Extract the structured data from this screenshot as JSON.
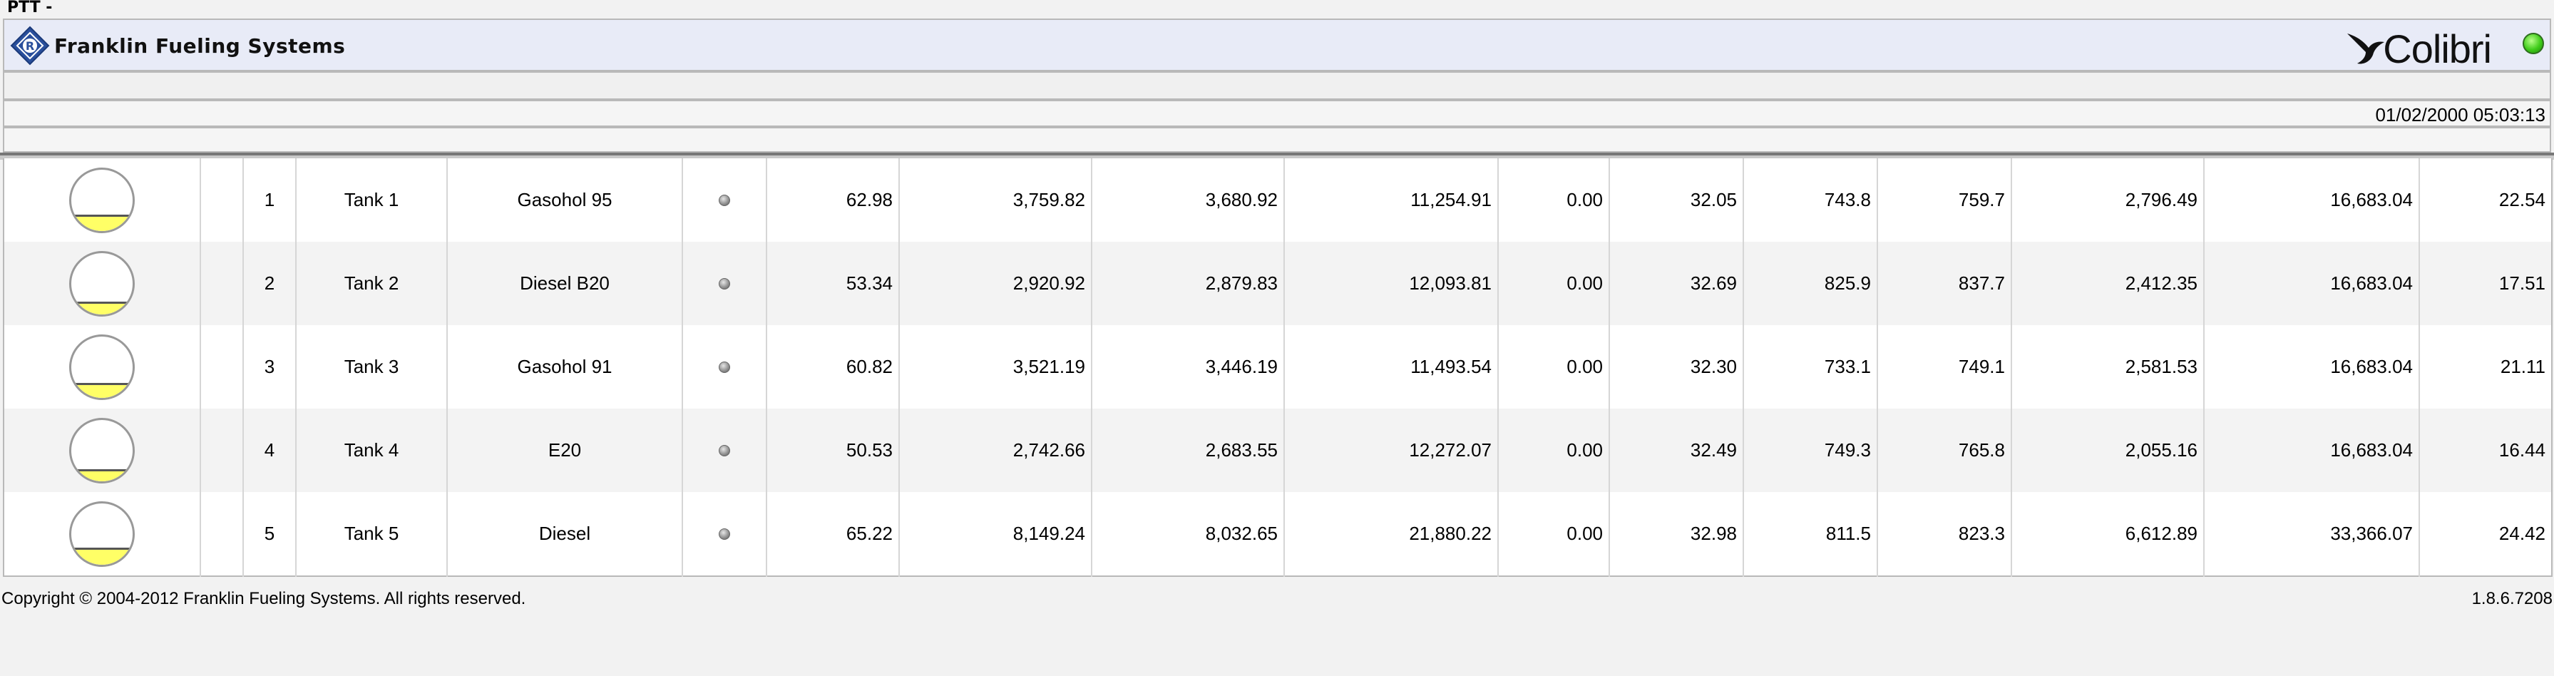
{
  "window": {
    "title": "PTT -"
  },
  "header": {
    "brand_name": "Franklin Fueling Systems",
    "product_logo_text": "Colibri",
    "brand_icon": "franklin-diamond-logo",
    "status_color": "#44cc22"
  },
  "info_bar": {
    "datetime": "01/02/2000 05:03:13"
  },
  "colors": {
    "gauge_fill": "#ffff66",
    "row_alt": "#f3f3f3"
  },
  "tanks": [
    {
      "level": 0.23,
      "number": "1",
      "name": "Tank 1",
      "product": "Gasohol 95",
      "v1": "62.98",
      "v2": "3,759.82",
      "v3": "3,680.92",
      "v4": "11,254.91",
      "v5": "0.00",
      "v6": "32.05",
      "v7": "743.8",
      "v8": "759.7",
      "v9": "2,796.49",
      "v10": "16,683.04",
      "v11": "22.54"
    },
    {
      "level": 0.18,
      "number": "2",
      "name": "Tank 2",
      "product": "Diesel B20",
      "v1": "53.34",
      "v2": "2,920.92",
      "v3": "2,879.83",
      "v4": "12,093.81",
      "v5": "0.00",
      "v6": "32.69",
      "v7": "825.9",
      "v8": "837.7",
      "v9": "2,412.35",
      "v10": "16,683.04",
      "v11": "17.51"
    },
    {
      "level": 0.21,
      "number": "3",
      "name": "Tank 3",
      "product": "Gasohol 91",
      "v1": "60.82",
      "v2": "3,521.19",
      "v3": "3,446.19",
      "v4": "11,493.54",
      "v5": "0.00",
      "v6": "32.30",
      "v7": "733.1",
      "v8": "749.1",
      "v9": "2,581.53",
      "v10": "16,683.04",
      "v11": "21.11"
    },
    {
      "level": 0.16,
      "number": "4",
      "name": "Tank 4",
      "product": "E20",
      "v1": "50.53",
      "v2": "2,742.66",
      "v3": "2,683.55",
      "v4": "12,272.07",
      "v5": "0.00",
      "v6": "32.49",
      "v7": "749.3",
      "v8": "765.8",
      "v9": "2,055.16",
      "v10": "16,683.04",
      "v11": "16.44"
    },
    {
      "level": 0.24,
      "number": "5",
      "name": "Tank 5",
      "product": "Diesel",
      "v1": "65.22",
      "v2": "8,149.24",
      "v3": "8,032.65",
      "v4": "21,880.22",
      "v5": "0.00",
      "v6": "32.98",
      "v7": "811.5",
      "v8": "823.3",
      "v9": "6,612.89",
      "v10": "33,366.07",
      "v11": "24.42"
    }
  ],
  "footer": {
    "copyright": "Copyright © 2004-2012 Franklin Fueling Systems. All rights reserved.",
    "version": "1.8.6.7208"
  }
}
